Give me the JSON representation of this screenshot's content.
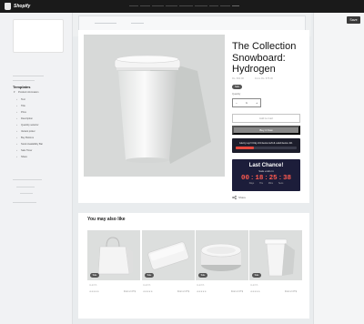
{
  "topbar": {
    "brand": "Shopify"
  },
  "header": {
    "save_label": "Save"
  },
  "sidebar": {
    "templates_title": "Templates",
    "items": [
      {
        "label": "Product information"
      },
      {
        "label": "Text"
      },
      {
        "label": "Title"
      },
      {
        "label": "Price"
      },
      {
        "label": "Description"
      },
      {
        "label": "Quantity selector"
      },
      {
        "label": "Variant picker"
      },
      {
        "label": "Buy Buttons"
      },
      {
        "label": "Stock Availability Bar"
      },
      {
        "label": "Sale Timer"
      },
      {
        "label": "Share"
      }
    ]
  },
  "product": {
    "title": "The Collection Snowboard: Hydrogen",
    "price": "Rs. 600.00",
    "compare_price": "From Rs. 675.00",
    "badge": "Sale",
    "quantity_label": "Quantity",
    "quantity": "1",
    "minus": "−",
    "plus": "+",
    "add_to_cart": "Add to Cart",
    "buy_now": "Buy it Now",
    "stock_message": "Hurry up! Only 24 items left & sold items 10.",
    "stock_fraction": 0.3,
    "timer": {
      "title": "Last Chance!",
      "subtitle": "Sale ends in",
      "days": "00",
      "hours": "18",
      "minutes": "25",
      "seconds": "38",
      "label_days": "Days",
      "label_hours": "Hrs",
      "label_minutes": "Mins",
      "label_seconds": "Secs"
    },
    "share": "Share"
  },
  "recommendations": {
    "title": "You may also like",
    "cards": [
      {
        "badge": "Sale",
        "name": "ALEXIS",
        "stars": "★★★★★",
        "price": "From 2.47 $"
      },
      {
        "badge": "Sale",
        "name": "ALEXIS",
        "stars": "★★★★★",
        "price": "From 2.47 $"
      },
      {
        "badge": "Sale",
        "name": "ALEXIS",
        "stars": "★★★★★",
        "price": "From 2.47 $"
      },
      {
        "badge": "Sale",
        "name": "ALEXIS",
        "stars": "★★★★★",
        "price": "From 2.47 $"
      }
    ]
  }
}
